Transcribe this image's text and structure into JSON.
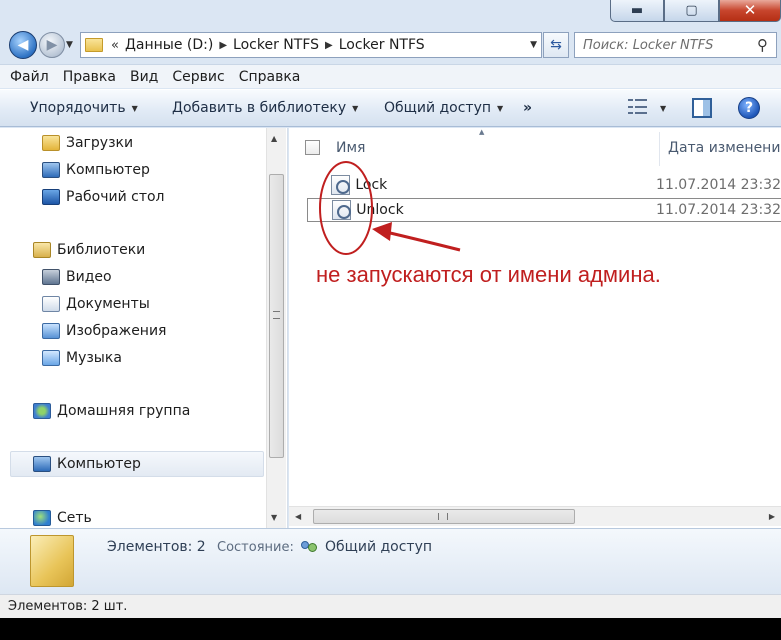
{
  "window": {
    "caption_min": "▬",
    "caption_max": "▢",
    "caption_close": "✕"
  },
  "address": {
    "breadcrumbs": [
      "Данные (D:)",
      "Locker NTFS",
      "Locker NTFS"
    ],
    "lead_sep": "«",
    "sep": "▶"
  },
  "search": {
    "placeholder": "Поиск: Locker NTFS"
  },
  "menu": {
    "items": [
      "Файл",
      "Правка",
      "Вид",
      "Сервис",
      "Справка"
    ]
  },
  "toolbar": {
    "organize": "Упорядочить",
    "add_to_library": "Добавить в библиотеку",
    "share": "Общий доступ",
    "more": "»",
    "help": "?"
  },
  "navpane": {
    "items": [
      {
        "label": "Загрузки",
        "icon": "downloads-icon"
      },
      {
        "label": "Компьютер",
        "icon": "computer-icon"
      },
      {
        "label": "Рабочий стол",
        "icon": "desktop-icon"
      },
      {
        "label": "Библиотеки",
        "icon": "libraries-icon"
      },
      {
        "label": "Видео",
        "icon": "video-icon"
      },
      {
        "label": "Документы",
        "icon": "documents-icon"
      },
      {
        "label": "Изображения",
        "icon": "images-icon"
      },
      {
        "label": "Музыка",
        "icon": "music-icon"
      },
      {
        "label": "Домашняя группа",
        "icon": "homegroup-icon"
      },
      {
        "label": "Компьютер",
        "icon": "computer-icon"
      },
      {
        "label": "Сеть",
        "icon": "network-icon"
      }
    ]
  },
  "content": {
    "columns": {
      "name": "Имя",
      "date": "Дата изменения"
    },
    "files": [
      {
        "name": "Lock",
        "date": "11.07.2014 23:32"
      },
      {
        "name": "Unlock",
        "date": "11.07.2014 23:32"
      }
    ]
  },
  "details": {
    "count_label": "Элементов: 2",
    "status_label": "Состояние:",
    "status_value": "Общий доступ"
  },
  "statusbar": {
    "text": "Элементов: 2 шт."
  },
  "annotation": {
    "text": "не запускаются от имени админа.",
    "color": "#c01f1f"
  }
}
